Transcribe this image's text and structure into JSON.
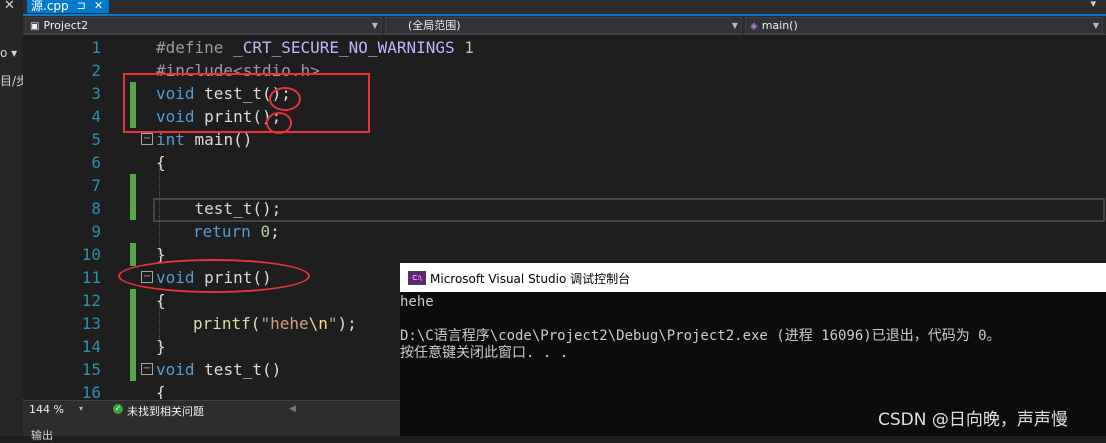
{
  "left_panel": {
    "close_glyph": "✕",
    "label_top": "o ▾",
    "label_bottom": "目/步"
  },
  "tabbar": {
    "tab_label": "源.cpp",
    "pin_glyph": "⊐",
    "close_glyph": "✕",
    "overflow_glyph": "▾"
  },
  "navbar": {
    "project": "Project2",
    "scope": "(全局范围)",
    "member": "main()"
  },
  "editor": {
    "line_numbers": [
      "1",
      "2",
      "3",
      "4",
      "5",
      "6",
      "7",
      "8",
      "9",
      "10",
      "11",
      "12",
      "13",
      "14",
      "15",
      "16"
    ],
    "lines": {
      "l1": {
        "directive": "#define",
        "macro": "_CRT_SECURE_NO_WARNINGS",
        "num": "1"
      },
      "l2": {
        "text": "#include<stdio.h>"
      },
      "l3": {
        "kw": "void",
        "rest": "test_t();"
      },
      "l4": {
        "kw": "void",
        "rest": "print();"
      },
      "l5": {
        "kw": "int",
        "rest": "main()"
      },
      "l6": {
        "text": "{"
      },
      "l7": {
        "text": ""
      },
      "l8": {
        "text": "    test_t();"
      },
      "l9": {
        "kw": "return",
        "num": "0",
        "semi": ";"
      },
      "l10": {
        "text": "}"
      },
      "l11": {
        "kw": "void",
        "rest": "print()"
      },
      "l12": {
        "text": "{"
      },
      "l13": {
        "fn": "printf",
        "open": "(",
        "str1": "\"hehe",
        "esc": "\\n",
        "str2": "\"",
        "close": ");"
      },
      "l14": {
        "text": "}"
      },
      "l15": {
        "kw": "void",
        "rest": "test_t()"
      },
      "l16": {
        "text": "{"
      }
    },
    "fold_glyph": "−"
  },
  "statusbar": {
    "zoom": "144 %",
    "zoom_arrow": "▾",
    "issues": "未找到相关问题",
    "ok_glyph": "✓",
    "scroll_glyph": "◀"
  },
  "bottom": {
    "label": "输出"
  },
  "console": {
    "title": "Microsoft Visual Studio 调试控制台",
    "icon_text": "C:\\",
    "output": [
      "hehe",
      "",
      "D:\\C语言程序\\code\\Project2\\Debug\\Project2.exe (进程 16096)已退出，代码为 0。",
      "按任意键关闭此窗口. . ."
    ]
  },
  "watermark": "CSDN @日向晚，声声慢",
  "colors": {
    "accent": "#007acc",
    "annotation": "#e8323c",
    "change_marker": "#57a64a"
  }
}
